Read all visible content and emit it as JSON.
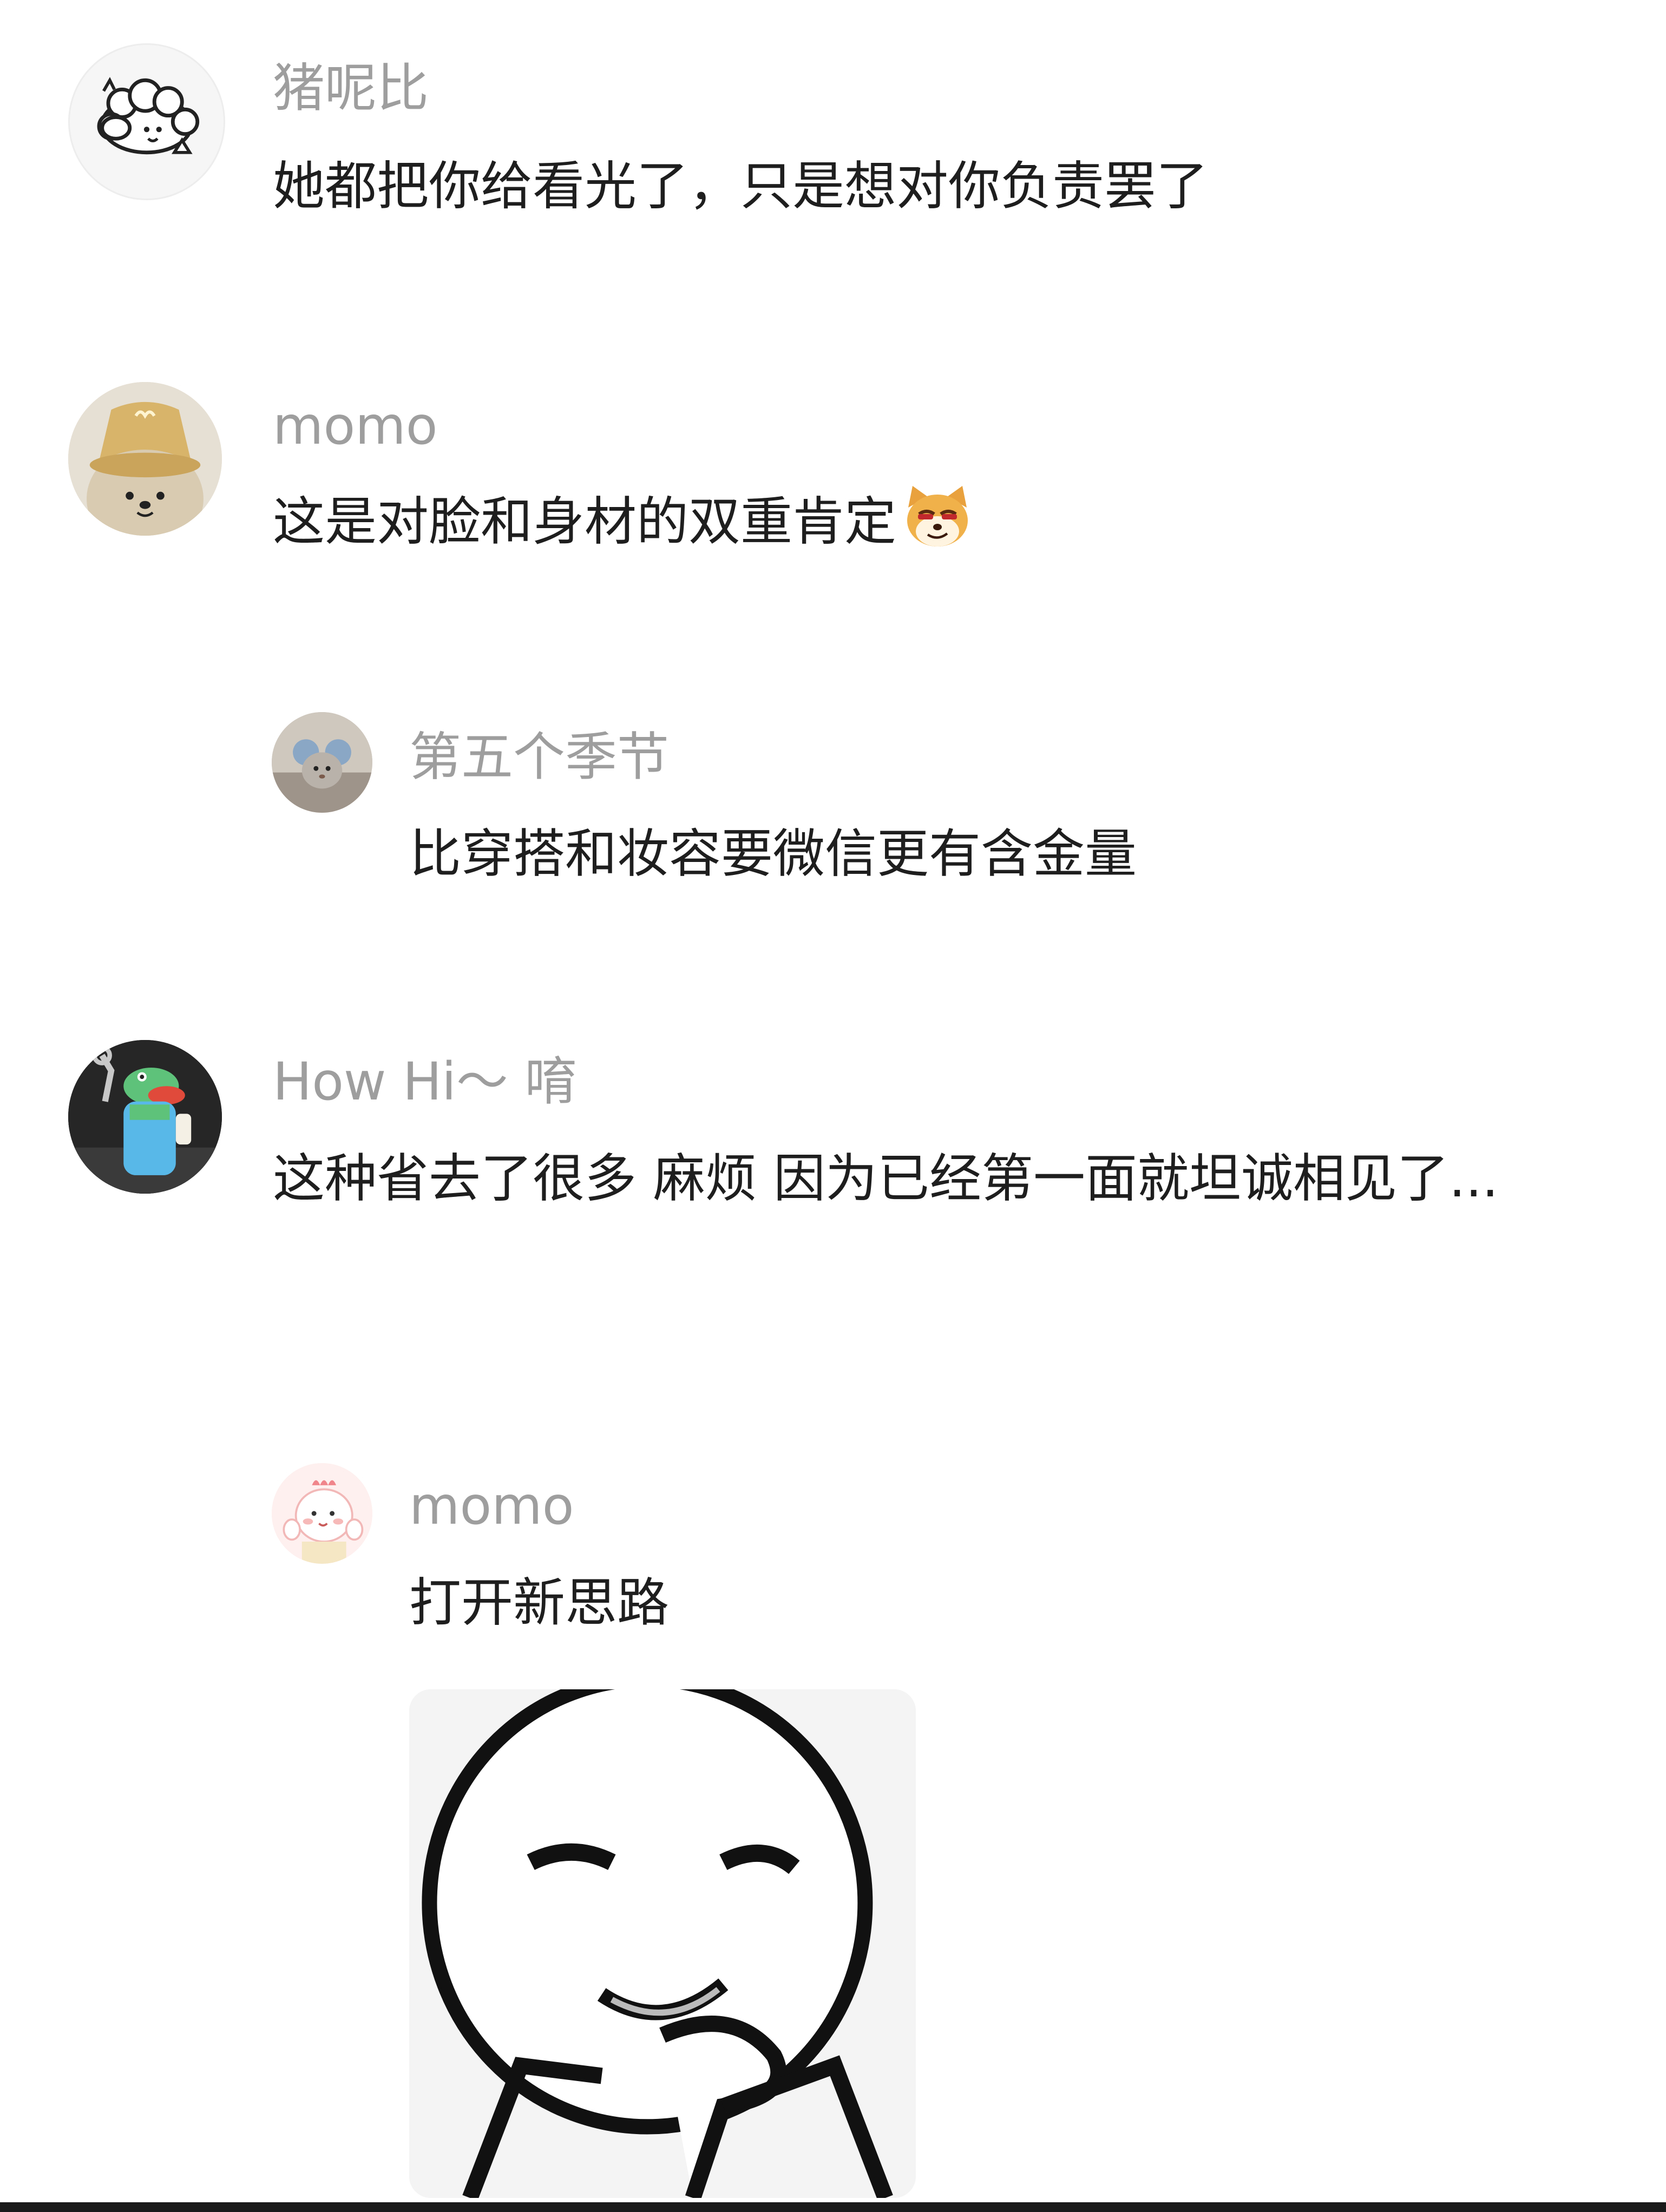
{
  "comments": [
    {
      "avatar_icon": "cartoon-sheep-avatar-icon",
      "username": "猪呢比",
      "text": "她都把你给看光了，只是想对你负责罢了"
    },
    {
      "avatar_icon": "bear-with-hat-avatar-icon",
      "username": "momo",
      "text": "这是对脸和身材的双重肯定",
      "emoji": "smug-shiba-dog-emoji-icon"
    },
    {
      "avatar_icon": "mouse-toy-photo-avatar-icon",
      "username": "第五个季节",
      "text": "比穿搭和妆容要微信更有含金量"
    },
    {
      "avatar_icon": "green-crocodile-plush-avatar-icon",
      "username": "How Hi～ 唷",
      "text": "这种省去了很多 麻烦 因为已经第一面就坦诚相见了..."
    },
    {
      "avatar_icon": "pink-dinosaur-avatar-icon",
      "username": "momo",
      "text": "打开新思路",
      "sticker": "thinking-face-meme-sticker-icon"
    }
  ]
}
